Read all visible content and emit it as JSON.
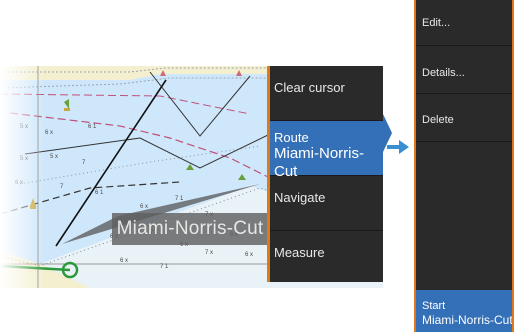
{
  "chart": {
    "route_label": "Miami-Norris-Cut"
  },
  "context_menu": {
    "items": [
      {
        "label": "Clear cursor"
      },
      {
        "label": "Route",
        "sublabel": "Miami-Norris-Cut",
        "selected": true
      },
      {
        "label": "Navigate"
      },
      {
        "label": "Measure"
      }
    ]
  },
  "route_menu": {
    "items": [
      {
        "label": "Edit..."
      },
      {
        "label": "Details..."
      },
      {
        "label": "Delete"
      }
    ],
    "start": {
      "label": "Start",
      "sublabel": "Miami-Norris-Cut"
    }
  },
  "colors": {
    "accent": "#3470b8",
    "menu_bg": "#2a2a2a",
    "edge": "#e07818",
    "water": "#cfe7fb",
    "land": "#f3efcf"
  }
}
